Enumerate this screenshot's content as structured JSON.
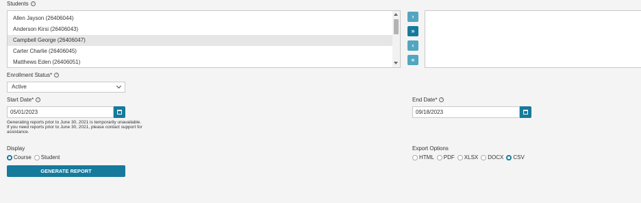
{
  "students": {
    "label": "Students",
    "items": [
      {
        "name": "Allen Jayson (26406044)",
        "selected": false
      },
      {
        "name": "Anderson Kirsi (26406043)",
        "selected": false
      },
      {
        "name": "Campbell George (26406047)",
        "selected": true
      },
      {
        "name": "Carter Charlie (26406045)",
        "selected": false
      },
      {
        "name": "Matthews Eden (26406051)",
        "selected": false
      }
    ],
    "transfer": {
      "add": "›",
      "add_all": "»",
      "remove": "‹",
      "remove_all": "«"
    }
  },
  "enrollment_status": {
    "label": "Enrollment Status*",
    "value": "Active"
  },
  "start_date": {
    "label": "Start Date*",
    "value": "05/01/2023"
  },
  "end_date": {
    "label": "End Date*",
    "value": "09/18/2023"
  },
  "note": "Generating reports prior to June 30, 2021 is temporarily unavailable. If you need reports prior to June 30, 2021, please contact support for assistance.",
  "display": {
    "label": "Display",
    "options": [
      {
        "label": "Course",
        "checked": true
      },
      {
        "label": "Student",
        "checked": false
      }
    ]
  },
  "export": {
    "label": "Export Options",
    "options": [
      {
        "label": "HTML",
        "checked": false
      },
      {
        "label": "PDF",
        "checked": false
      },
      {
        "label": "XLSX",
        "checked": false
      },
      {
        "label": "DOCX",
        "checked": false
      },
      {
        "label": "CSV",
        "checked": true
      }
    ]
  },
  "generate_label": "GENERATE REPORT",
  "colors": {
    "primary": "#167a9c",
    "primary_light": "#52a6c0",
    "background": "#f4f4f4"
  }
}
